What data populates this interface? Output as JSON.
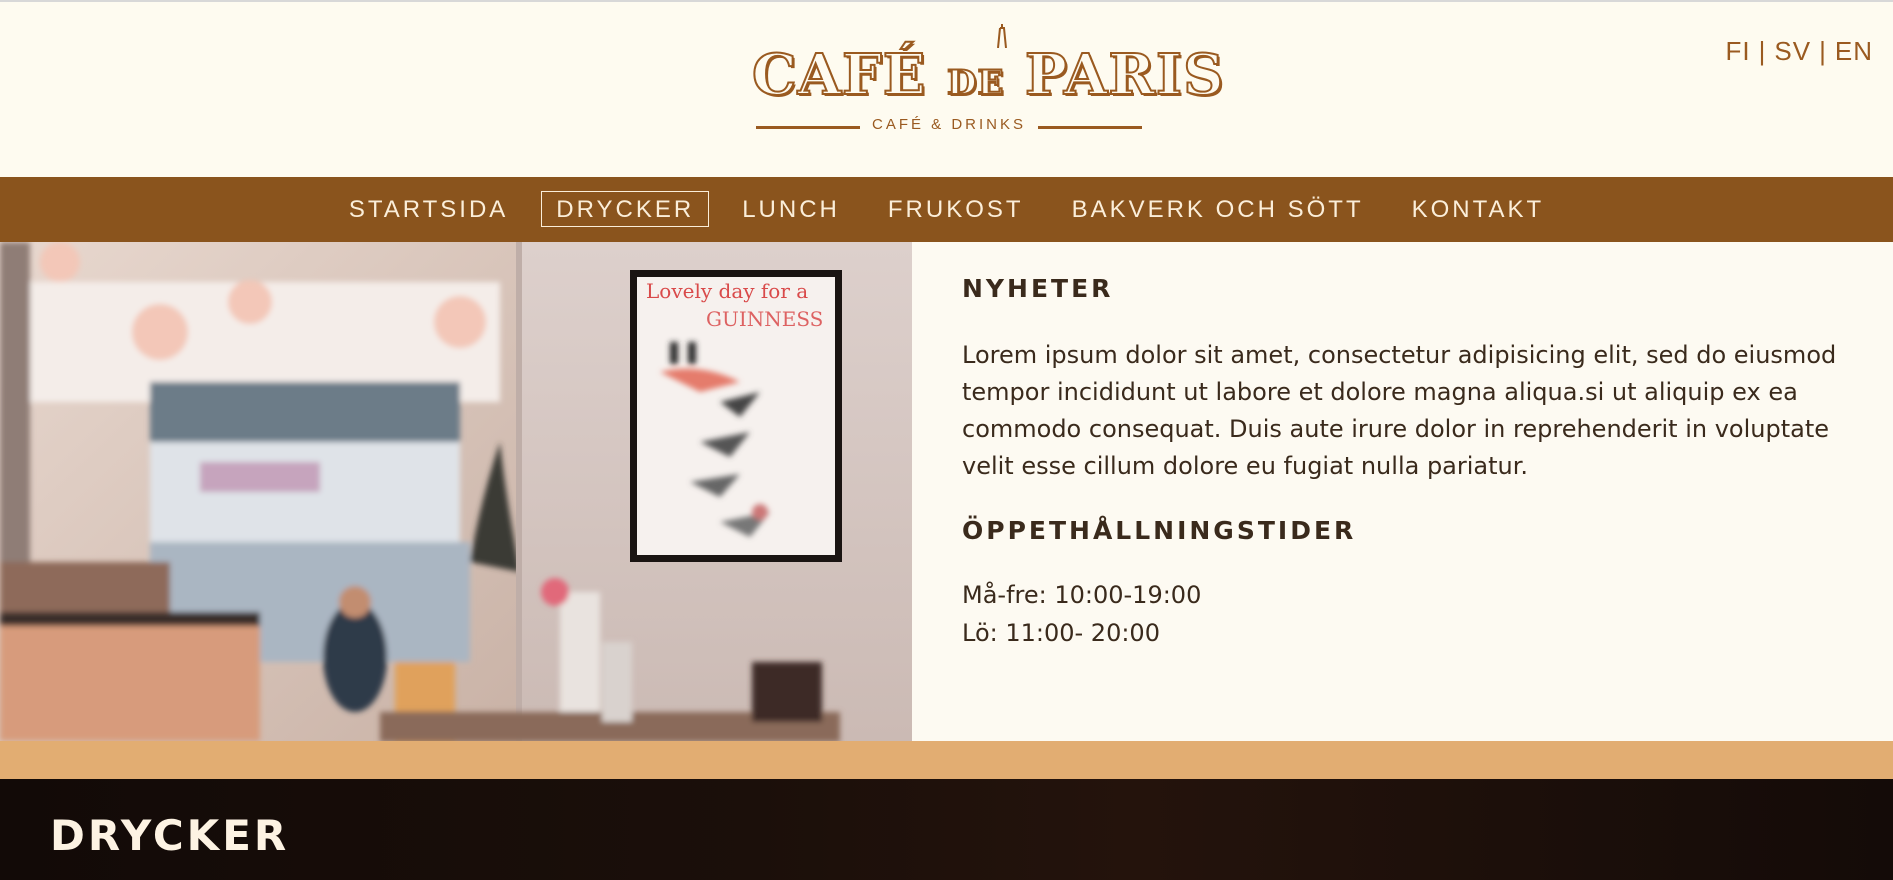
{
  "header": {
    "logo_title_a": "CAFÉ ",
    "logo_title_b": "DE",
    "logo_title_c": " PARIS",
    "logo_subtitle": "CAFÉ & DRINKS",
    "languages": [
      "FI",
      "SV",
      "EN"
    ],
    "lang_separator": "|"
  },
  "nav": {
    "items": [
      {
        "label": "STARTSIDA"
      },
      {
        "label": "DRYCKER"
      },
      {
        "label": "LUNCH"
      },
      {
        "label": "FRUKOST"
      },
      {
        "label": "BAKVERK OCH SÖTT"
      },
      {
        "label": "KONTAKT"
      }
    ],
    "active": "DRYCKER"
  },
  "hero": {
    "poster_text_1": "Lovely day for a",
    "poster_text_2": "GUINNESS"
  },
  "news": {
    "title": "NYHETER",
    "body": "Lorem ipsum dolor sit amet, consectetur adipisicing elit, sed do eiusmod tempor incididunt ut labore et dolore magna aliqua.si ut aliquip ex ea commodo consequat. Duis aute irure dolor in reprehenderit in voluptate velit esse cillum dolore eu fugiat nulla pariatur."
  },
  "hours": {
    "title": "ÖPPETHÅLLNINGSTIDER",
    "lines": [
      "Må-fre: 10:00-19:00",
      "Lö: 11:00- 20:00"
    ]
  },
  "section": {
    "title": "DRYCKER"
  },
  "colors": {
    "brand_brown": "#8a541d",
    "logo_brown": "#9a5a20",
    "cream": "#fefbf0",
    "tan": "#e2ad72",
    "dark": "#140b08"
  }
}
